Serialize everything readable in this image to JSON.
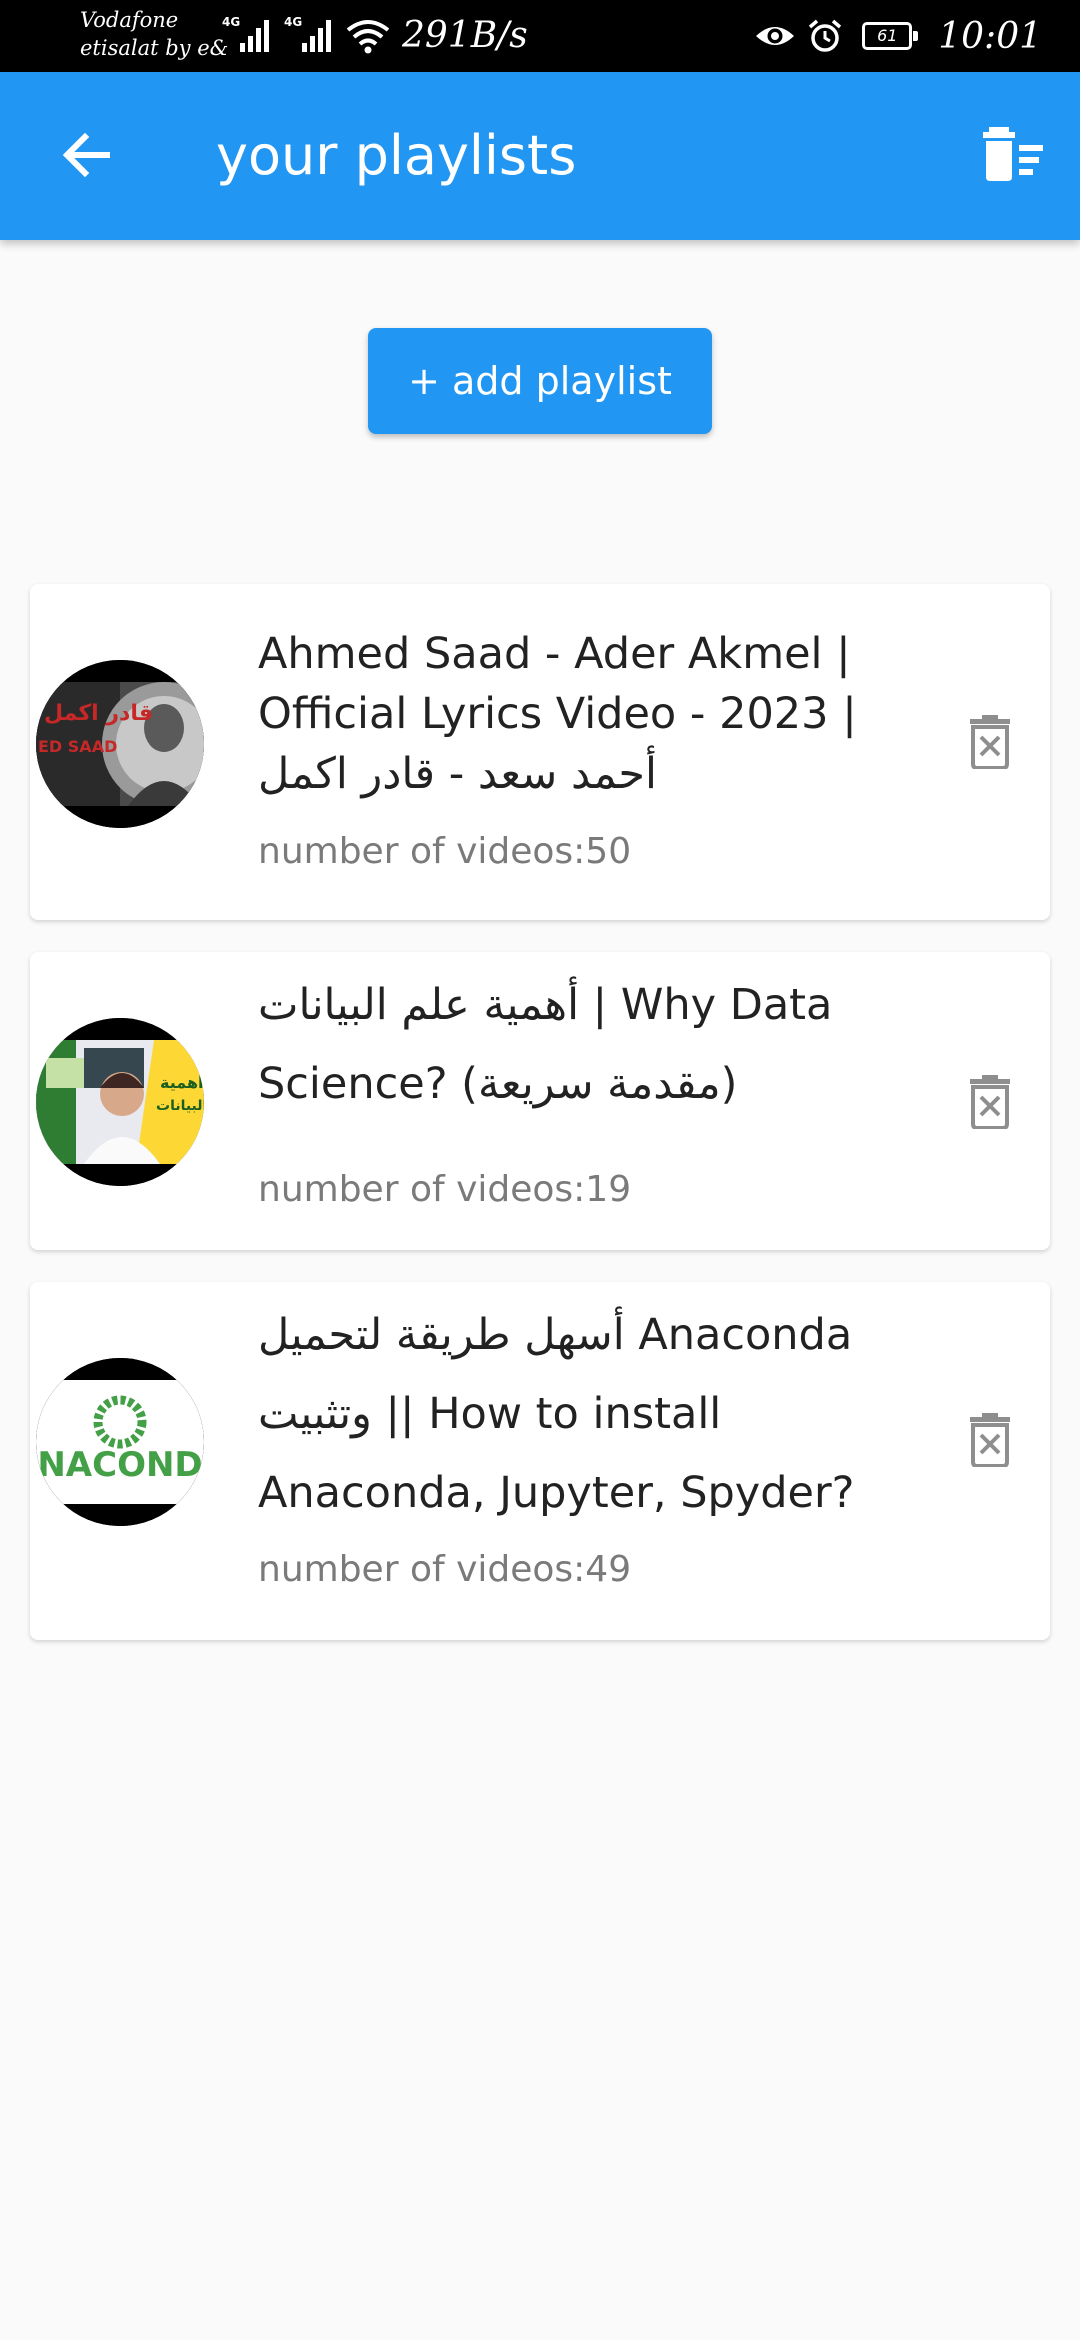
{
  "status_bar": {
    "carrier_line1": "Vodafone",
    "carrier_line2": "etisalat by e&",
    "network_tag_1": "4G",
    "network_tag_2": "4G",
    "net_speed": "291B/s",
    "battery": "61",
    "time": "10:01"
  },
  "app_bar": {
    "title": "your playlists",
    "back_icon": "arrow-left-icon",
    "delete_all_icon": "delete-sweep-icon"
  },
  "add_button": {
    "label": "+ add playlist"
  },
  "playlists": [
    {
      "title": "Ahmed Saad - Ader Akmel | Official Lyrics Video - 2023 | أحمد سعد - قادر اكمل",
      "count": "number of videos:50",
      "thumb_text": "قادر اكمل",
      "thumb_subtext": "ED SAAD"
    },
    {
      "title": "أهمية علم البيانات | Why Data Science? (مقدمة سريعة)",
      "count": "number of videos:19",
      "thumb_text": "أهمية",
      "thumb_subtext": "البيانات"
    },
    {
      "title": "أسهل طريقة لتحميل Anaconda وتثبيت || How to install Anaconda, Jupyter, Spyder?",
      "count": "number of videos:49",
      "thumb_text": "ANACONDA"
    }
  ],
  "colors": {
    "primary": "#2196f3",
    "background": "#fafafa",
    "delete_icon": "#8e8e8e",
    "count_text": "#7a7a7a"
  }
}
